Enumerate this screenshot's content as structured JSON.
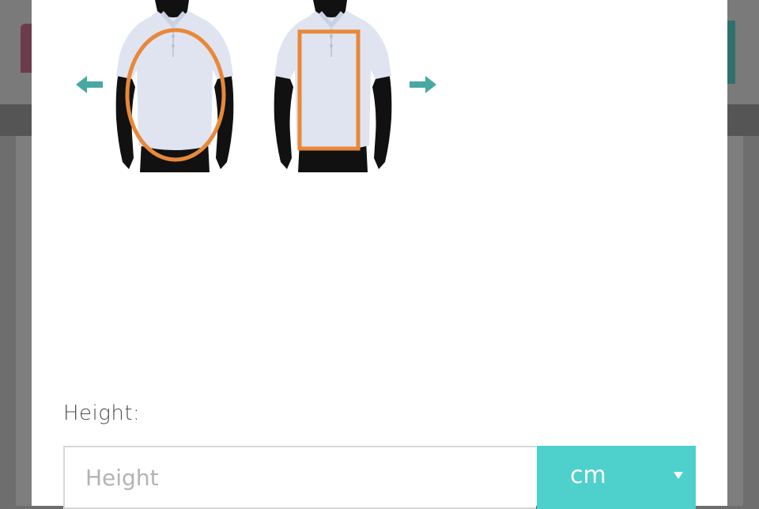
{
  "measurement_carousel": {
    "icons": [
      "arrow-left-icon",
      "chest-measurement-figure",
      "torso-length-figure",
      "arrow-right-icon"
    ],
    "colors": {
      "arrow": "#48a8a3",
      "highlight": "#e8883a",
      "shirt": "#dfe4f0",
      "silhouette": "#111111"
    }
  },
  "height": {
    "label": "Height:",
    "placeholder": "Height",
    "value": ""
  },
  "unit_select": {
    "selected": "cm",
    "color": "#4ed0cc"
  }
}
